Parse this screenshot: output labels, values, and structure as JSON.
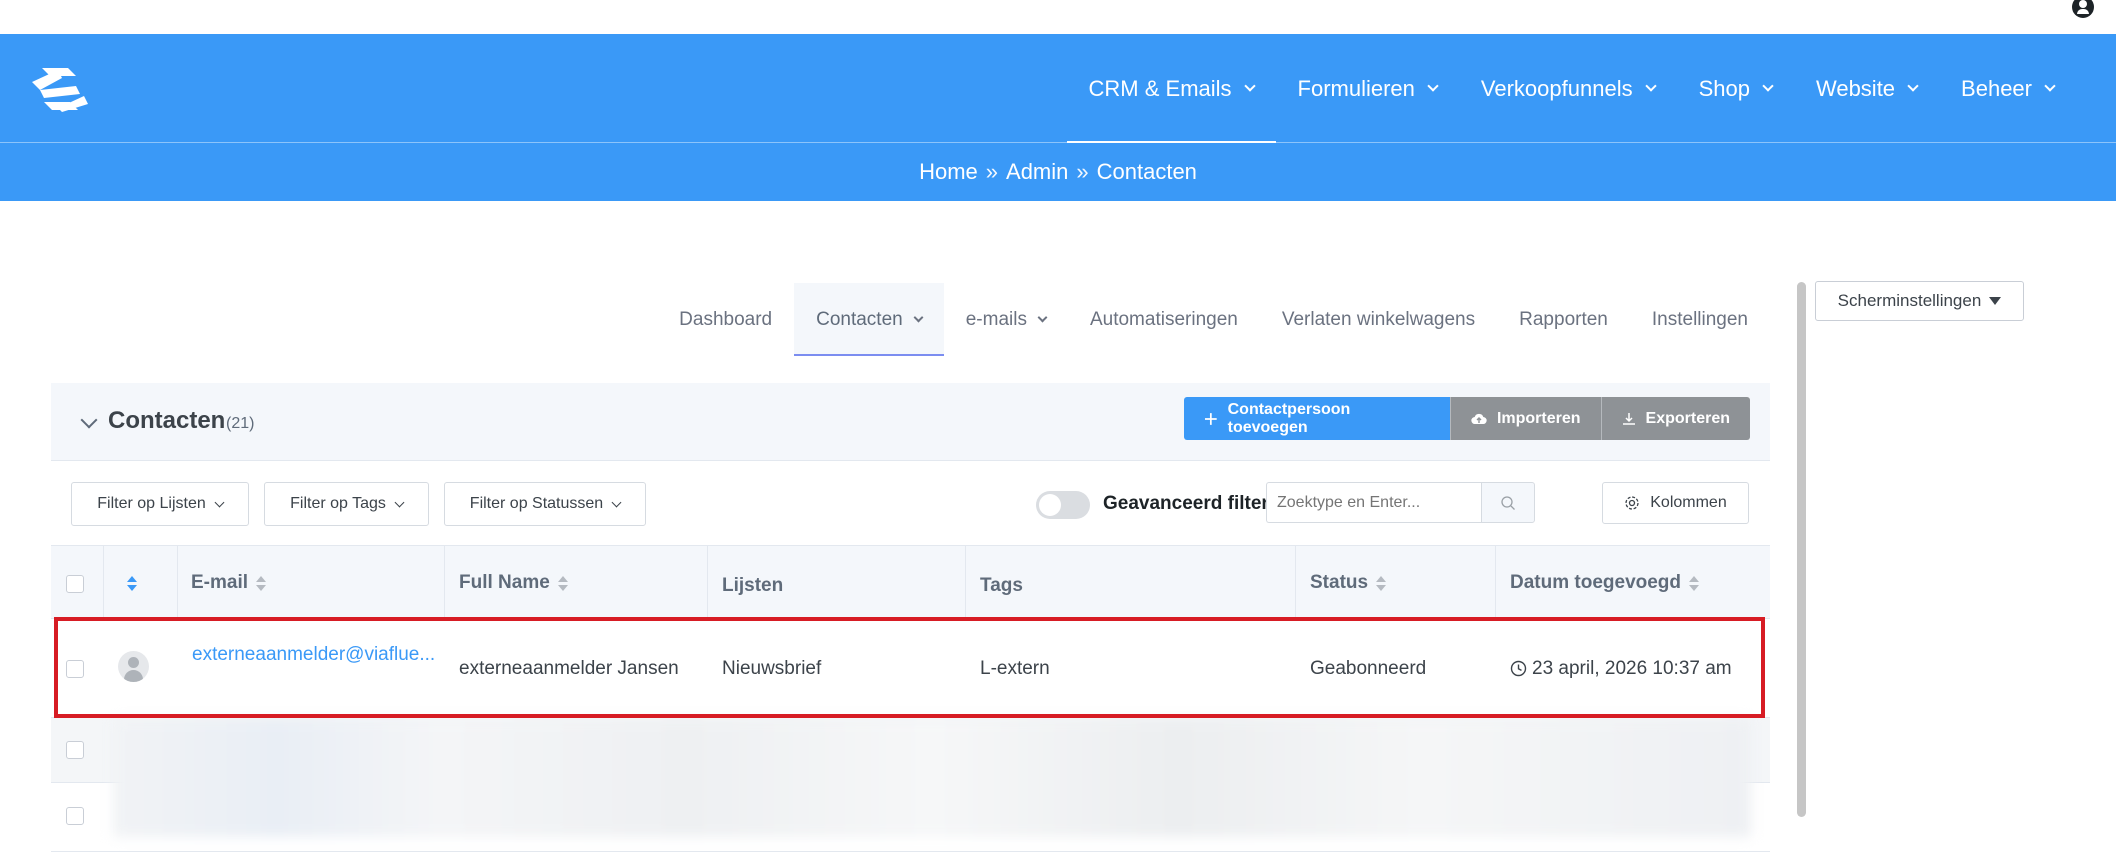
{
  "header": {
    "nav": [
      {
        "label": "CRM & Emails",
        "active": true
      },
      {
        "label": "Formulieren",
        "active": false
      },
      {
        "label": "Verkoopfunnels",
        "active": false
      },
      {
        "label": "Shop",
        "active": false
      },
      {
        "label": "Website",
        "active": false
      },
      {
        "label": "Beheer",
        "active": false
      }
    ]
  },
  "breadcrumb": {
    "items": [
      "Home",
      "Admin",
      "Contacten"
    ],
    "separator": "»"
  },
  "subnav": {
    "tabs": [
      {
        "label": "Dashboard",
        "has_dropdown": false,
        "active": false
      },
      {
        "label": "Contacten",
        "has_dropdown": true,
        "active": true
      },
      {
        "label": "e-mails",
        "has_dropdown": true,
        "active": false
      },
      {
        "label": "Automatiseringen",
        "has_dropdown": false,
        "active": false
      },
      {
        "label": "Verlaten winkelwagens",
        "has_dropdown": false,
        "active": false
      },
      {
        "label": "Rapporten",
        "has_dropdown": false,
        "active": false
      },
      {
        "label": "Instellingen",
        "has_dropdown": false,
        "active": false
      }
    ]
  },
  "screen_settings": {
    "label": "Scherminstellingen"
  },
  "panel": {
    "title": "Contacten",
    "count": "(21)",
    "buttons": {
      "add": "Contactpersoon toevoegen",
      "import": "Importeren",
      "export": "Exporteren"
    }
  },
  "filters": {
    "lists": "Filter op Lijsten",
    "tags": "Filter op Tags",
    "statuses": "Filter op Statussen",
    "advanced_label": "Geavanceerd filter",
    "search_placeholder": "Zoektype en Enter...",
    "columns_label": "Kolommen"
  },
  "table": {
    "columns": {
      "email": "E-mail",
      "full_name": "Full Name",
      "lists": "Lijsten",
      "tags": "Tags",
      "status": "Status",
      "date_added": "Datum toegevoegd"
    },
    "rows": [
      {
        "email": "externeaanmelder@viaflue...",
        "full_name": "externeaanmelder Jansen",
        "lists": "Nieuwsbrief",
        "tags": "L-extern",
        "status": "Geabonneerd",
        "date_added": "23 april, 2026 10:37 am"
      }
    ]
  },
  "colors": {
    "brand_blue": "#3a99f7",
    "highlight_red": "#d71c24",
    "button_gray": "#8e9296"
  },
  "icons": [
    "logo-icon",
    "user-icon",
    "chevron-down-icon",
    "plus-icon",
    "cloud-upload-icon",
    "download-icon",
    "search-icon",
    "gear-icon",
    "sort-icon",
    "clock-icon",
    "avatar-icon"
  ]
}
